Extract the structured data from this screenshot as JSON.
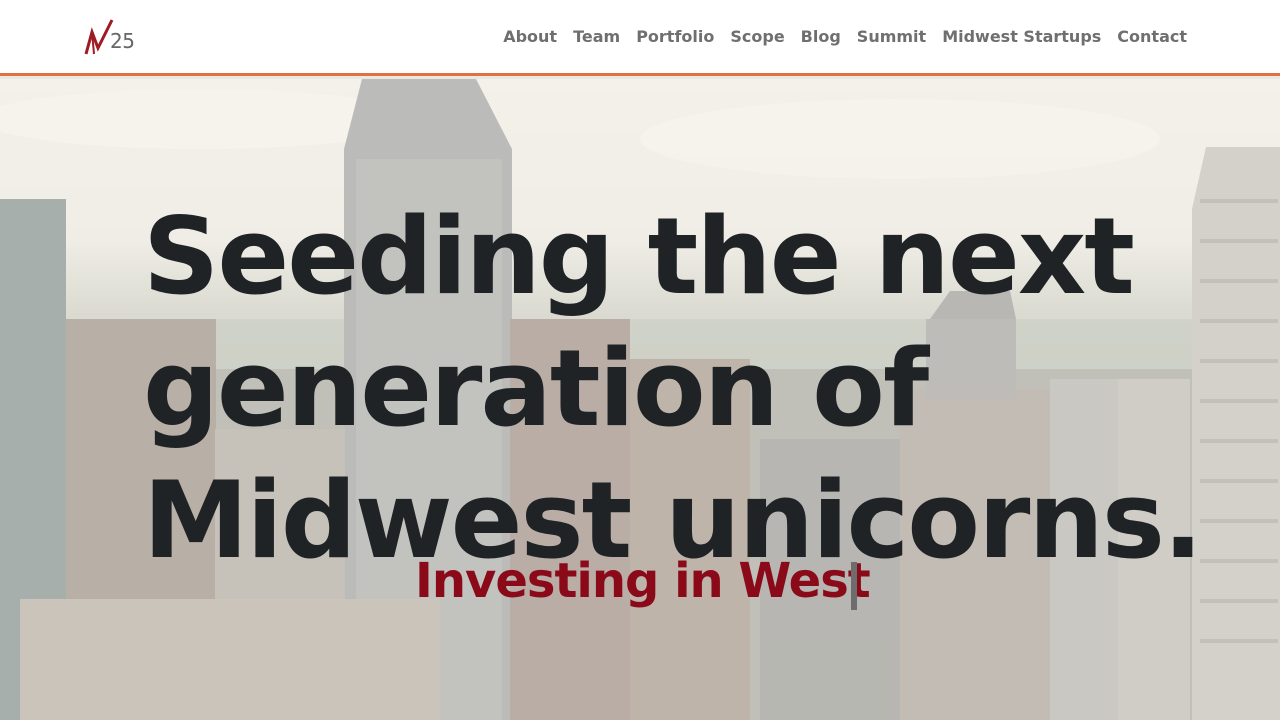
{
  "header": {
    "logo": {
      "mark_text": "25",
      "accent": "#9e1b24"
    },
    "nav": [
      {
        "label": "About"
      },
      {
        "label": "Team"
      },
      {
        "label": "Portfolio"
      },
      {
        "label": "Scope"
      },
      {
        "label": "Blog"
      },
      {
        "label": "Summit"
      },
      {
        "label": "Midwest Startups"
      },
      {
        "label": "Contact"
      }
    ],
    "border_color": "#e0703f"
  },
  "hero": {
    "headline_lines": [
      "Seeding the next",
      "generation of",
      "Midwest unicorns."
    ],
    "tagline": "Investing in West",
    "tagline_color": "#8b0a1a"
  }
}
